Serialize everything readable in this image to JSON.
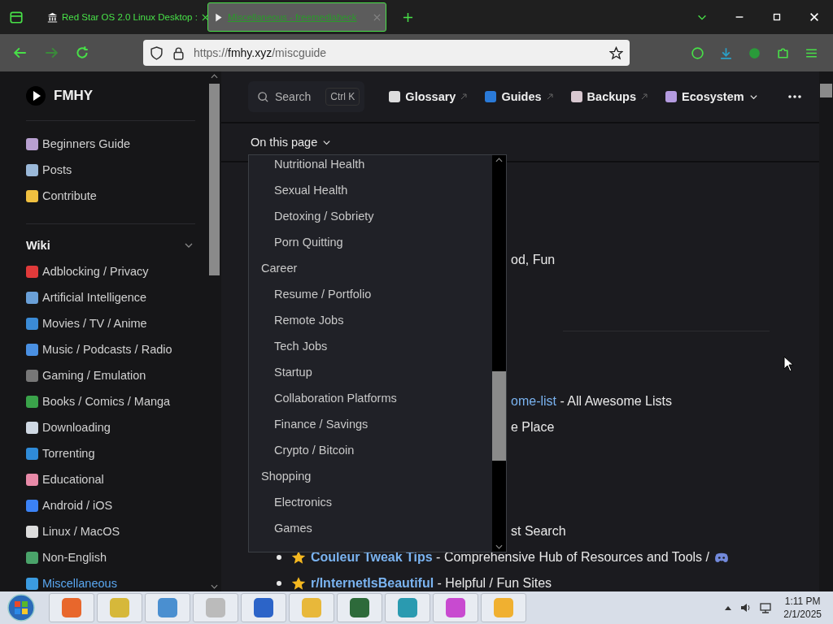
{
  "browser": {
    "tabs": [
      {
        "title": "Red Star OS 2.0 Linux Desktop :",
        "selected": false
      },
      {
        "title": "Miscellaneous - freemediaheck",
        "selected": true
      }
    ],
    "url": {
      "scheme": "https://",
      "host": "fmhy.xyz",
      "path": "/miscguide"
    }
  },
  "site": {
    "name": "FMHY",
    "search": {
      "placeholder": "Search",
      "shortcut": "Ctrl K"
    },
    "nav": [
      {
        "label": "Glossary",
        "kind": "external"
      },
      {
        "label": "Guides",
        "kind": "external"
      },
      {
        "label": "Backups",
        "kind": "external"
      },
      {
        "label": "Ecosystem",
        "kind": "menu"
      }
    ]
  },
  "sidebar": {
    "top_links": [
      "Beginners Guide",
      "Posts",
      "Contribute"
    ],
    "section": {
      "title": "Wiki",
      "expanded": true
    },
    "items": [
      {
        "label": "Adblocking / Privacy",
        "selected": false
      },
      {
        "label": "Artificial Intelligence",
        "selected": false
      },
      {
        "label": "Movies / TV / Anime",
        "selected": false
      },
      {
        "label": "Music / Podcasts / Radio",
        "selected": false
      },
      {
        "label": "Gaming / Emulation",
        "selected": false
      },
      {
        "label": "Books / Comics / Manga",
        "selected": false
      },
      {
        "label": "Downloading",
        "selected": false
      },
      {
        "label": "Torrenting",
        "selected": false
      },
      {
        "label": "Educational",
        "selected": false
      },
      {
        "label": "Android / iOS",
        "selected": false
      },
      {
        "label": "Linux / MacOS",
        "selected": false
      },
      {
        "label": "Non-English",
        "selected": false
      },
      {
        "label": "Miscellaneous",
        "selected": true
      }
    ]
  },
  "outline": {
    "label": "On this page",
    "expanded": true,
    "items": [
      {
        "children": [
          "Nutritional Health",
          "Sexual Health",
          "Detoxing / Sobriety",
          "Porn Quitting"
        ]
      },
      {
        "label": "Career",
        "children": [
          "Resume / Portfolio",
          "Remote Jobs",
          "Tech Jobs",
          "Startup",
          "Collaboration Platforms",
          "Finance / Savings",
          "Crypto / Bitcoin"
        ]
      },
      {
        "label": "Shopping",
        "children": [
          "Electronics",
          "Games"
        ]
      }
    ]
  },
  "content": {
    "partial_lines": [
      {
        "text": "od, Fun"
      },
      {
        "link": "ome-list",
        "text": "- All Awesome Lists"
      },
      {
        "text": "e Place"
      },
      {
        "text": "st Search"
      }
    ],
    "list": [
      {
        "link": "Couleur Tweak Tips",
        "text": "- Comprehensive Hub of Resources and Tools /",
        "starred": true
      },
      {
        "link": "r/InternetIsBeautiful",
        "text": "- Helpful / Fun Sites",
        "starred": true
      }
    ]
  },
  "taskbar": {
    "time": "1:11 PM",
    "date": "2/1/2025"
  }
}
